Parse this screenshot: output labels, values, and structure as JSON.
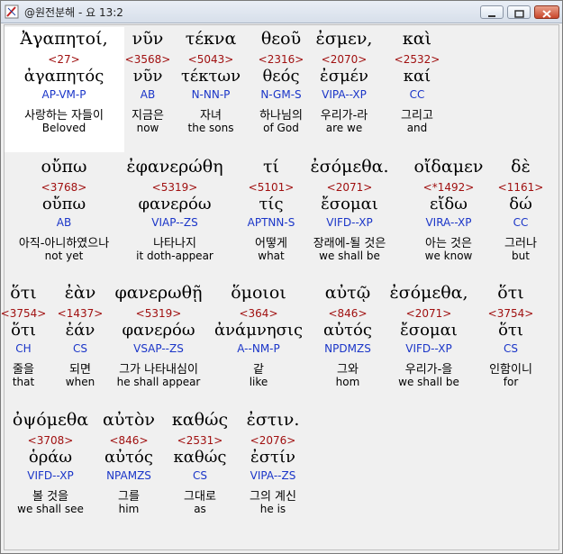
{
  "window": {
    "title": "@원전분해 - 요 13:2",
    "buttons": {
      "minimize": "minimize",
      "maximize": "maximize",
      "close": "close"
    }
  },
  "words": [
    {
      "greek": "Ἀγαπητοί,",
      "num": "<27>",
      "lemma": "ἀγαπητός",
      "parse": "AP-VM-P",
      "korean": "사랑하는 자들이",
      "english": "Beloved",
      "highlighted": true
    },
    {
      "greek": "νῦν",
      "num": "<3568>",
      "lemma": "νῦν",
      "parse": "AB",
      "korean": "지금은",
      "english": "now"
    },
    {
      "greek": "τέκνα",
      "num": "<5043>",
      "lemma": "τέκτων",
      "parse": "N-NN-P",
      "korean": "자녀",
      "english": "the sons"
    },
    {
      "greek": "θεοῦ",
      "num": "<2316>",
      "lemma": "θεός",
      "parse": "N-GM-S",
      "korean": "하나님의",
      "english": "of God"
    },
    {
      "greek": "ἐσμεν,",
      "num": "<2070>",
      "lemma": "ἐσμέν",
      "parse": "VIPA--XP",
      "korean": "우리가-라",
      "english": "are we"
    },
    {
      "greek": "καὶ",
      "num": "<2532>",
      "lemma": "καί",
      "parse": "CC",
      "korean": "그리고",
      "english": "and"
    },
    {
      "greek": "οὔπω",
      "num": "<3768>",
      "lemma": "οὔπω",
      "parse": "AB",
      "korean": "아직-아니하였으나",
      "english": "not yet"
    },
    {
      "greek": "ἐφανερώθη",
      "num": "<5319>",
      "lemma": "φανερόω",
      "parse": "VIAP--ZS",
      "korean": "나타나지",
      "english": "it doth-appear"
    },
    {
      "greek": "τί",
      "num": "<5101>",
      "lemma": "τίς",
      "parse": "APTNN-S",
      "korean": "어떻게",
      "english": "what"
    },
    {
      "greek": "ἐσόμεθα.",
      "num": "<2071>",
      "lemma": "ἔσομαι",
      "parse": "VIFD--XP",
      "korean": "장래에-될 것은",
      "english": "we shall be"
    },
    {
      "greek": "οἴδαμεν",
      "num": "<*1492>",
      "lemma": "εἴδω",
      "parse": "VIRA--XP",
      "korean": "아는 것은",
      "english": "we know"
    },
    {
      "greek": "δὲ",
      "num": "<1161>",
      "lemma": "δώ",
      "parse": "CC",
      "korean": "그러나",
      "english": "but"
    },
    {
      "greek": "ὅτι",
      "num": "<3754>",
      "lemma": "ὅτι",
      "parse": "CH",
      "korean": "줄을",
      "english": "that"
    },
    {
      "greek": "ἐὰν",
      "num": "<1437>",
      "lemma": "ἐάν",
      "parse": "CS",
      "korean": "되면",
      "english": "when"
    },
    {
      "greek": "φανερωθῇ",
      "num": "<5319>",
      "lemma": "φανερόω",
      "parse": "VSAP--ZS",
      "korean": "그가 나타내심이",
      "english": "he shall appear"
    },
    {
      "greek": "ὅμοιοι",
      "num": "<364>",
      "lemma": "ἀνάμνησις",
      "parse": "A--NM-P",
      "korean": "같",
      "english": "like"
    },
    {
      "greek": "αὐτῷ",
      "num": "<846>",
      "lemma": "αὐτός",
      "parse": "NPDMZS",
      "korean": "그와",
      "english": "hom"
    },
    {
      "greek": "ἐσόμεθα,",
      "num": "<2071>",
      "lemma": "ἔσομαι",
      "parse": "VIFD--XP",
      "korean": "우리가-을",
      "english": "we shall be"
    },
    {
      "greek": "ὅτι",
      "num": "<3754>",
      "lemma": "ὅτι",
      "parse": "CS",
      "korean": "인함이니",
      "english": "for"
    },
    {
      "greek": "ὀψόμεθα",
      "num": "<3708>",
      "lemma": "ὁράω",
      "parse": "VIFD--XP",
      "korean": "볼 것을",
      "english": "we shall see"
    },
    {
      "greek": "αὐτὸν",
      "num": "<846>",
      "lemma": "αὐτός",
      "parse": "NPAMZS",
      "korean": "그를",
      "english": "him"
    },
    {
      "greek": "καθώς",
      "num": "<2531>",
      "lemma": "καθώς",
      "parse": "CS",
      "korean": "그대로",
      "english": "as"
    },
    {
      "greek": "ἐστιν.",
      "num": "<2076>",
      "lemma": "ἐστίν",
      "parse": "VIPA--ZS",
      "korean": "그의 계신",
      "english": "he is"
    }
  ]
}
